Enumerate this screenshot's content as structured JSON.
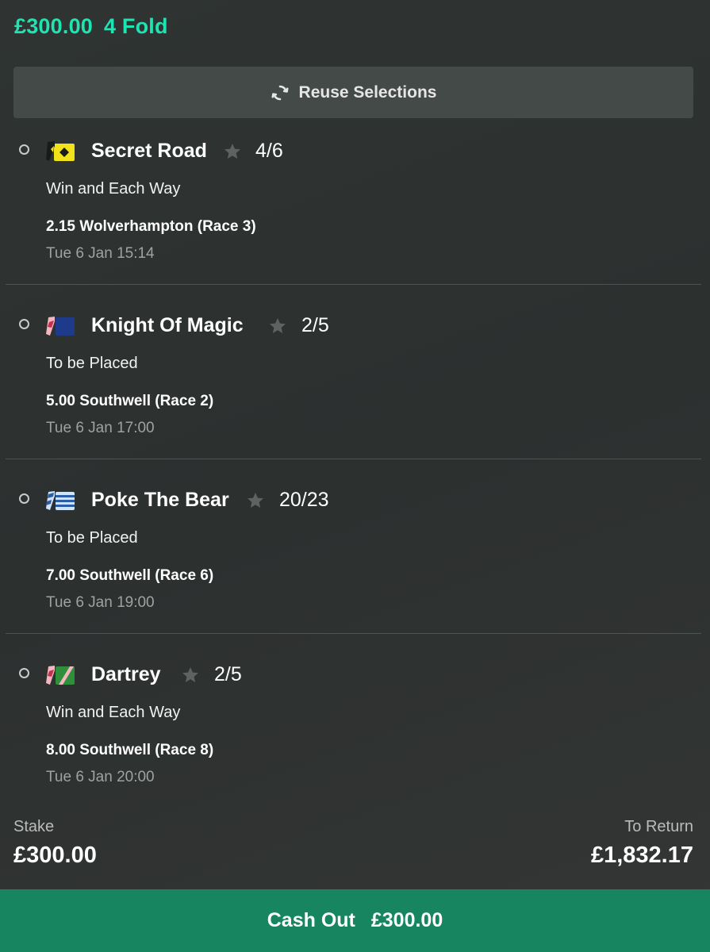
{
  "header": {
    "stake": "£300.00",
    "bet_type": "4 Fold"
  },
  "reuse_button": {
    "label": "Reuse Selections",
    "icon": "refresh-icon"
  },
  "selections": [
    {
      "name": "Secret Road",
      "odds": "4/6",
      "market": "Win and Each Way",
      "event": "2.15 Wolverhampton (Race 3)",
      "time": "Tue 6 Jan 15:14",
      "silk_colors": [
        "#f2e21a",
        "#1a1a1a"
      ]
    },
    {
      "name": "Knight Of Magic",
      "odds": "2/5",
      "market": "To be Placed",
      "event": "5.00 Southwell (Race 2)",
      "time": "Tue 6 Jan 17:00",
      "silk_colors": [
        "#1e3a8a",
        "#f4b6c2"
      ]
    },
    {
      "name": "Poke The Bear",
      "odds": "20/23",
      "market": "To be Placed",
      "event": "7.00 Southwell (Race 6)",
      "time": "Tue 6 Jan 19:00",
      "silk_colors": [
        "#cfe3f7",
        "#2a5ca8"
      ]
    },
    {
      "name": "Dartrey",
      "odds": "2/5",
      "market": "Win and Each Way",
      "event": "8.00 Southwell (Race 8)",
      "time": "Tue 6 Jan 20:00",
      "silk_colors": [
        "#2f8f3a",
        "#f4b6c2"
      ]
    }
  ],
  "footer": {
    "stake_label": "Stake",
    "stake_value": "£300.00",
    "return_label": "To Return",
    "return_value": "£1,832.17"
  },
  "cashout": {
    "label": "Cash Out",
    "amount": "£300.00"
  },
  "colors": {
    "accent": "#20e3b2",
    "cashout_bg": "#168560",
    "background": "#2f3432"
  }
}
